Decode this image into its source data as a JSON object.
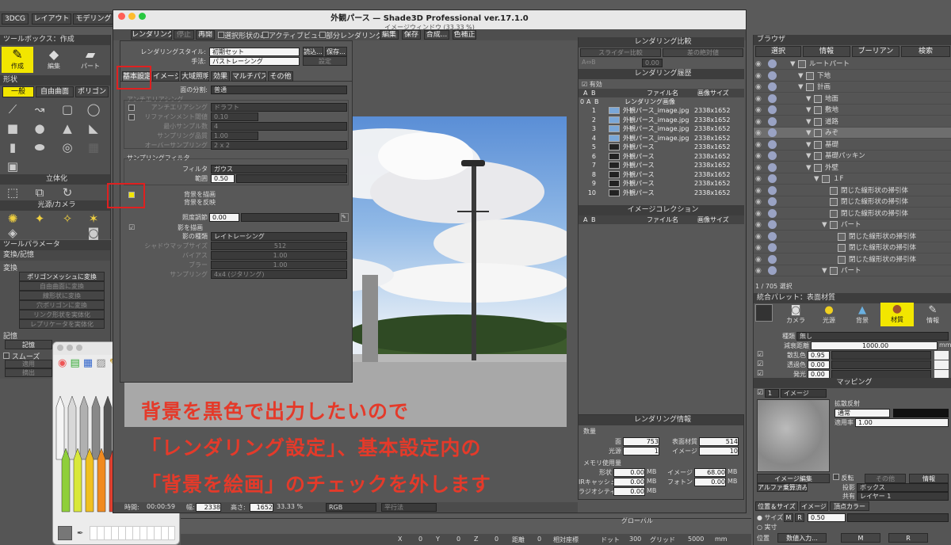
{
  "topbar": {
    "tab1": "3DCG",
    "tab2": "レイアウト",
    "tab3": "モデリング"
  },
  "window": {
    "title": "外観パース — Shade3D Professional ver.17.1.0",
    "subtitle": "イメージウィンドウ (33.33 %)"
  },
  "toolbar": {
    "items": [
      "レンダリング",
      "停止",
      "再開"
    ],
    "checks": [
      "選択形状のみ",
      "アクティブビュー",
      "部分レンダリング"
    ],
    "menus": [
      "編集",
      "保存",
      "合成...",
      "色補正"
    ]
  },
  "settings": {
    "style_label": "レンダリングスタイル:",
    "style_value": "初期セット",
    "load": "読込...",
    "save": "保存...",
    "method_label": "手法:",
    "method_value": "パストレーシング",
    "method_btn": "設定",
    "tabs": [
      "基本設定",
      "イメージ",
      "大域照明",
      "効果",
      "マルチパス",
      "その他"
    ],
    "face_div_label": "面の分割:",
    "face_div_value": "普通",
    "aa_title": "アンチエリアシング",
    "aa_label": "アンチエリアシング",
    "aa_value": "ドラフト",
    "refine_label": "リファインメント閾値",
    "refine_value": "0.10",
    "min_label": "最小サンプル数",
    "min_value": "4",
    "quality_label": "サンプリング品質",
    "quality_value": "1.00",
    "over_label": "オーバーサンプリング",
    "over_value": "2 x 2",
    "sf_title": "サンプリングフィルタ",
    "filter_label": "フィルタ",
    "filter_value": "ガウス",
    "range_label": "範囲",
    "range_value": "0.50",
    "bg_draw": "背景を描画",
    "bg_reflect": "背景を反映",
    "illum_label": "照度調節",
    "illum_value": "0.00",
    "shadow_draw": "影を描画",
    "shadow_type_label": "影の種類",
    "shadow_type_value": "レイトレーシング",
    "smap_label": "シャドウマップサイズ",
    "smap_value": "512",
    "bias_label": "バイアス",
    "bias_value": "1.00",
    "blur_label": "ブラー",
    "blur_value": "1.00",
    "samp_label": "サンプリング",
    "samp_value": "4x4 (ジタリング)"
  },
  "status": {
    "time_label": "時間:",
    "time_value": "00:00:59",
    "w_label": "幅:",
    "w_value": "2338",
    "h_label": "高さ:",
    "h_value": "1652",
    "zoom": "33.33 %",
    "color": "RGB",
    "filter": "平行法"
  },
  "left": {
    "toolbox_title": "ツールボックス：作成",
    "tools": [
      "作成",
      "編集",
      "パート"
    ],
    "shape_title": "形状",
    "shape_tabs": [
      "一般",
      "自由曲面",
      "ポリゴン"
    ],
    "solid_title": "立体化",
    "light_title": "光源/カメラ",
    "param_title": "ツールパラメータ",
    "conv_title": "変換/記憶",
    "conv_sub": "変換",
    "conv_btns": [
      "ポリゴンメッシュに変換",
      "自由曲面に変換",
      "線形状に変換",
      "穴ポリゴンに変換",
      "リンク形状を実体化",
      "レプリケータを実体化"
    ],
    "memory_title": "記憶",
    "memory_btn": "記憶",
    "smooth": "スムーズ",
    "apply": "適用",
    "extract": "摘出"
  },
  "compare": {
    "title": "レンダリング比較",
    "slider": "スライダー比較",
    "diff": "差の絶対値",
    "ab": "A⇔B",
    "zoom": "0.00",
    "hist_title": "レンダリング履歴",
    "enabled": "有効",
    "cols": [
      "A",
      "B",
      "ファイル名",
      "画像サイズ"
    ],
    "hist_head": "レンダリング画像",
    "rows": [
      {
        "n": "1",
        "name": "外観パース_image.jpg",
        "size": "2338x1652"
      },
      {
        "n": "2",
        "name": "外観パース_image.jpg",
        "size": "2338x1652"
      },
      {
        "n": "3",
        "name": "外観パース_image.jpg",
        "size": "2338x1652"
      },
      {
        "n": "4",
        "name": "外観パース_image.jpg",
        "size": "2338x1652"
      },
      {
        "n": "5",
        "name": "外観パース",
        "size": "2338x1652"
      },
      {
        "n": "6",
        "name": "外観パース",
        "size": "2338x1652"
      },
      {
        "n": "7",
        "name": "外観パース",
        "size": "2338x1652"
      },
      {
        "n": "8",
        "name": "外観パース",
        "size": "2338x1652"
      },
      {
        "n": "9",
        "name": "外観パース",
        "size": "2338x1652"
      },
      {
        "n": "10",
        "name": "外観パース",
        "size": "2338x1652"
      }
    ],
    "coll_title": "イメージコレクション"
  },
  "info": {
    "title": "レンダリング情報",
    "count": "数量",
    "face_l": "面",
    "face_v": "753",
    "mat_l": "表面材質",
    "mat_v": "514",
    "light_l": "光源",
    "light_v": "1",
    "img_l": "イメージ",
    "img_v": "10",
    "mem": "メモリ使用量",
    "shape_l": "形状",
    "shape_v": "0.00",
    "mb": "MB",
    "imgm_l": "イメージ",
    "imgm_v": "68.00",
    "ir_l": "IRキャッシュ",
    "ir_v": "0.00",
    "photon_l": "フォトン",
    "photon_v": "0.00",
    "rad_l": "ラジオシティ",
    "rad_v": "0.00"
  },
  "browser": {
    "title": "ブラウザ",
    "tabs": [
      "選択",
      "情報",
      "ブーリアン",
      "検索"
    ],
    "items": [
      {
        "t": "ルートパート",
        "d": 1
      },
      {
        "t": "下地",
        "d": 2
      },
      {
        "t": "計画",
        "d": 2
      },
      {
        "t": "地面",
        "d": 3
      },
      {
        "t": "敷地",
        "d": 3
      },
      {
        "t": "道路",
        "d": 3
      },
      {
        "t": "みぞ",
        "d": 3
      },
      {
        "t": "基礎",
        "d": 3
      },
      {
        "t": "基礎パッキン",
        "d": 3
      },
      {
        "t": "外壁",
        "d": 3
      },
      {
        "t": "１F",
        "d": 4
      },
      {
        "t": "閉じた線形状の掃引体",
        "d": 5
      },
      {
        "t": "閉じた線形状の掃引体",
        "d": 5
      },
      {
        "t": "閉じた線形状の掃引体",
        "d": 5
      },
      {
        "t": "パート",
        "d": 5
      },
      {
        "t": "閉じた線形状の掃引体",
        "d": 6
      },
      {
        "t": "閉じた線形状の掃引体",
        "d": 6
      },
      {
        "t": "閉じた線形状の掃引体",
        "d": 6
      },
      {
        "t": "パート",
        "d": 5
      }
    ],
    "count": "1 / 705 選択"
  },
  "palette": {
    "title": "統合パレット：表面材質",
    "tabs": [
      "カメラ",
      "光源",
      "背景",
      "材質",
      "情報"
    ],
    "kind_l": "種類",
    "kind_v": "無し",
    "att_l": "減衰距離",
    "att_v": "1000.00",
    "mm": "mm",
    "diffuse_l": "散乱色",
    "diffuse_v": "0.95",
    "trans_l": "透過色",
    "trans_v": "0.00",
    "emit_l": "発光",
    "emit_v": "0.00",
    "mapping": "マッピング",
    "map_idx": "1",
    "map_type": "イメージ",
    "diff_refl": "拡散反射",
    "normal": "通常",
    "rate_l": "適用率",
    "rate_v": "1.00",
    "edit": "イメージ編集",
    "info": "情報",
    "alpha": "アルファ乗算済み",
    "proj_l": "投影",
    "proj_v": "ボックス",
    "share_l": "共有",
    "share_v": "レイヤー 1",
    "reflect": "反転",
    "other": "その他"
  },
  "bottom": {
    "tabs": [
      "位置＆サイズ",
      "イメージ",
      "頂点カラー"
    ],
    "size": "サイズ",
    "size_v": "0.50",
    "actual": "実寸",
    "pos": "位置",
    "num": "数値入力...",
    "m": "M",
    "r": "R"
  },
  "footer": {
    "x": "X",
    "xv": "0",
    "y": "Y",
    "yv": "0",
    "z": "Z",
    "zv": "0",
    "dist": "距離",
    "dv": "0",
    "rel": "相対座標",
    "dot": "ドット",
    "dotv": "300",
    "grid": "グリッド",
    "gridv": "5000",
    "mm": "mm",
    "global": "グローバル"
  },
  "captions": [
    "背景を黒色で出力したいので",
    "「レンダリング設定」、基本設定内の",
    "「背景を絵画」のチェックを外します"
  ]
}
